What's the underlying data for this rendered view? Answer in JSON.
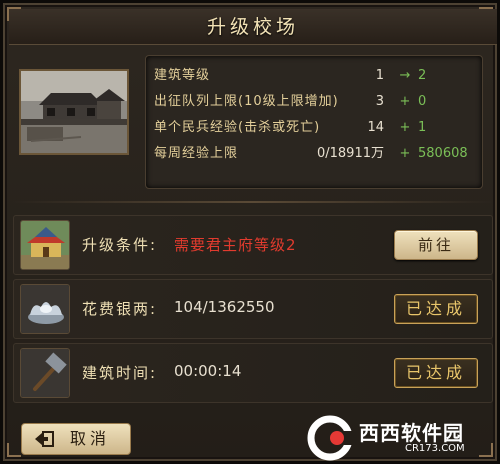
{
  "title": "升级校场",
  "stats": [
    {
      "label": "建筑等级",
      "current": "1",
      "op": "→",
      "next": "2"
    },
    {
      "label": "出征队列上限(10级上限增加)",
      "current": "3",
      "op": "+",
      "next": "0"
    },
    {
      "label": "单个民兵经验(击杀或死亡)",
      "current": "14",
      "op": "+",
      "next": "1"
    },
    {
      "label": "每周经验上限",
      "current": "0/18911万",
      "op": "+",
      "next": "580608"
    }
  ],
  "requirements": [
    {
      "label": "升级条件:",
      "value": "需要君主府等级2",
      "button": "前往",
      "icon": "palace-icon"
    },
    {
      "label": "花费银两:",
      "value": "104/1362550",
      "button": "已达成",
      "icon": "silver-ingot-icon"
    },
    {
      "label": "建筑时间:",
      "value": "00:00:14",
      "button": "已达成",
      "icon": "hammer-icon"
    }
  ],
  "cancel": {
    "label": "取消",
    "icon": "back-arrow-icon"
  },
  "watermark": {
    "big": "西西软件园",
    "small": "CR173.COM"
  },
  "colors": {
    "requirement_red": "#e23b2e",
    "increase_green": "#7bbf57",
    "title_gold": "#f3e3b6"
  }
}
